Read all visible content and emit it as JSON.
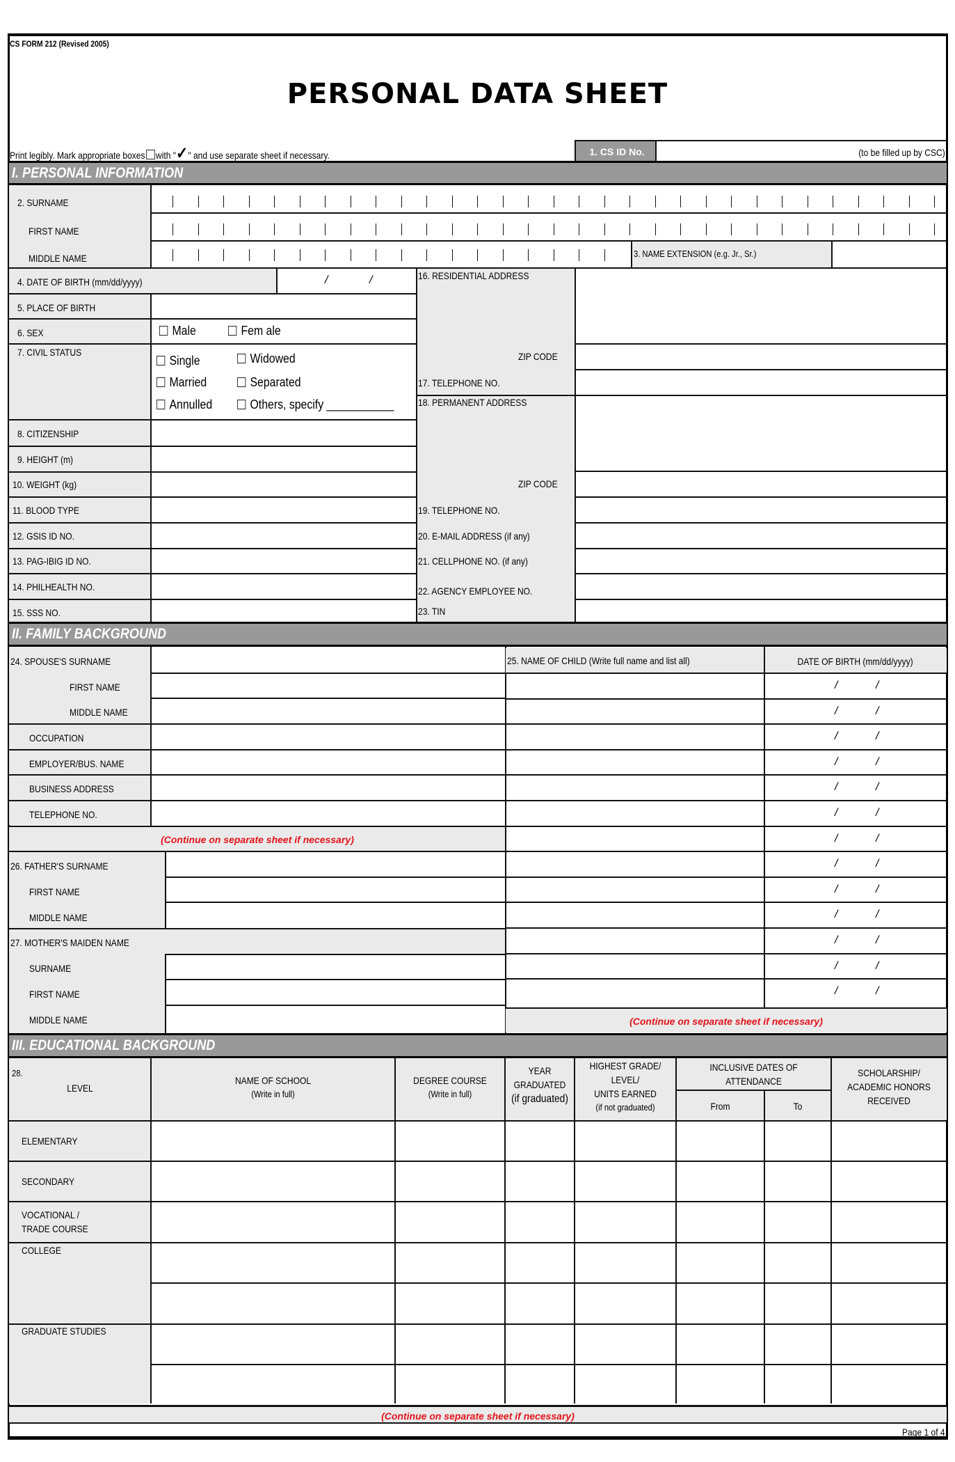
{
  "header": {
    "form_code": "CS FORM 212 (Revised 2005)",
    "title": "PERSONAL DATA SHEET",
    "instruction_pre": "Print legibly.  Mark appropriate boxes",
    "instruction_mid": "with \"",
    "instruction_post": "\" and use separate sheet if necessary.",
    "cs_id_label": "1. CS ID No.",
    "cs_id_note": "(to be filled up by CSC)",
    "cs_id_value": ""
  },
  "sections": {
    "personal": "I. PERSONAL INFORMATION",
    "family": "II.  FAMILY BACKGROUND",
    "education": "III.  EDUCATIONAL BACKGROUND"
  },
  "personal": {
    "surname": "2. SURNAME",
    "first_name": "FIRST NAME",
    "middle_name": "MIDDLE NAME",
    "name_extension": "3. NAME EXTENSION (e.g. Jr., Sr.)",
    "date_of_birth": "4. DATE OF BIRTH (mm/dd/yyyy)",
    "date_slash": "/",
    "place_of_birth": "5. PLACE OF BIRTH",
    "sex": "6. SEX",
    "sex_options": [
      "Male",
      "Fem ale"
    ],
    "civil_status": "7. CIVIL STATUS",
    "civil_options": [
      "Single",
      "Widowed",
      "Married",
      "Separated",
      "Annulled",
      "Others, specify ___________"
    ],
    "citizenship": "8. CITIZENSHIP",
    "height": "9. HEIGHT (m)",
    "weight": "10. WEIGHT (kg)",
    "blood_type": "11. BLOOD TYPE",
    "gsis": "12. GSIS ID NO.",
    "pagibig": "13. PAG-IBIG ID NO.",
    "philhealth": "14. PHILHEALTH NO.",
    "sss": "15. SSS NO.",
    "residential_address": "16. RESIDENTIAL ADDRESS",
    "zip_code": "ZIP CODE",
    "telephone_17": "17. TELEPHONE NO.",
    "permanent_address": "18. PERMANENT ADDRESS",
    "telephone_19": "19. TELEPHONE NO.",
    "email": "20. E-MAIL ADDRESS (if any)",
    "cellphone": "21. CELLPHONE NO. (if any)",
    "agency_employee": "22. AGENCY EMPLOYEE NO.",
    "tin": "23. TIN"
  },
  "family": {
    "spouse_surname": "24.  SPOUSE'S SURNAME",
    "first_name": "FIRST NAME",
    "middle_name": "MIDDLE NAME",
    "occupation": "OCCUPATION",
    "employer": "EMPLOYER/BUS. NAME",
    "business_address": "BUSINESS ADDRESS",
    "telephone": "TELEPHONE NO.",
    "continue_note": "(Continue on separate sheet if necessary)",
    "father_surname": "26.  FATHER'S SURNAME",
    "mother_maiden": "27.  MOTHER'S MAIDEN NAME",
    "surname": "SURNAME",
    "children_header": "25.  NAME OF CHILD (Write full name and list all)",
    "child_dob_header": "DATE OF BIRTH (mm/dd/yyyy)",
    "child_rows": 13
  },
  "education": {
    "number": "28.",
    "columns": {
      "level": "LEVEL",
      "school_1": "NAME OF SCHOOL",
      "school_2": "(Write in full)",
      "degree_1": "DEGREE COURSE",
      "degree_2": "(Write in full)",
      "year_1": "YEAR",
      "year_2": "GRADUATED",
      "year_3": "(if graduated)",
      "grade_1": "HIGHEST GRADE/",
      "grade_2": "LEVEL/",
      "grade_3": "UNITS EARNED",
      "grade_4": "(if not graduated)",
      "dates_1": "INCLUSIVE DATES OF",
      "dates_2": "ATTENDANCE",
      "from": "From",
      "to": "To",
      "honors_1": "SCHOLARSHIP/",
      "honors_2": "ACADEMIC HONORS",
      "honors_3": "RECEIVED"
    },
    "levels": [
      "ELEMENTARY",
      "SECONDARY",
      "VOCATIONAL /",
      "TRADE COURSE",
      "COLLEGE",
      "GRADUATE STUDIES"
    ],
    "continue_note": "(Continue on separate sheet if necessary)"
  },
  "footer": {
    "page": "Page 1 of 4"
  }
}
